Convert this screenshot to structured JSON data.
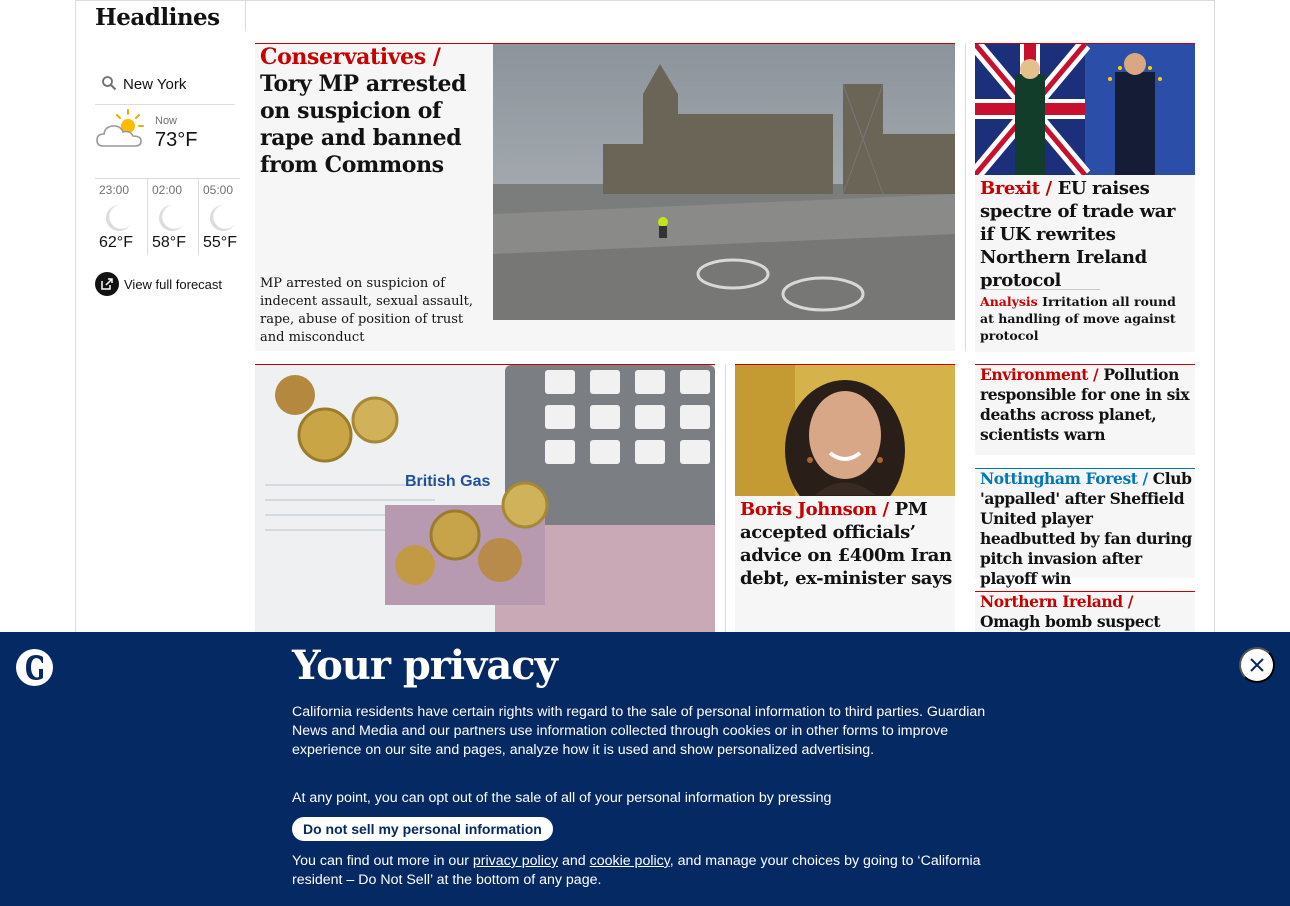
{
  "section": {
    "title": "Headlines"
  },
  "weather": {
    "city": "New York",
    "now_label": "Now",
    "now_temp": "73°F",
    "hours": [
      {
        "time": "23:00",
        "temp": "62°F",
        "icon": "moon-icon"
      },
      {
        "time": "02:00",
        "temp": "58°F",
        "icon": "moon-icon"
      },
      {
        "time": "05:00",
        "temp": "55°F",
        "icon": "moon-icon"
      }
    ],
    "forecast_link": "View full forecast"
  },
  "stories": {
    "main": {
      "kicker": "Conservatives /",
      "headline": "Tory MP arrested on suspicion of rape and banned from Commons",
      "standfirst": "MP arrested on suspicion of indecent assault, sexual assault, rape, abuse of position of trust and misconduct"
    },
    "brexit": {
      "kicker": "Brexit /",
      "headline": "EU raises spectre of trade war if UK rewrites Northern Ireland protocol",
      "analysis_kicker": "Analysis",
      "analysis_text": "Irritation all round at handling of move against protocol"
    },
    "environment": {
      "kicker": "Environment /",
      "headline": "Pollution responsible for one in six deaths across planet, scientists warn"
    },
    "forest": {
      "kicker": "Nottingham Forest /",
      "headline": "Club 'appalled' after Sheffield United player headbutted by fan during pitch invasion after playoff win"
    },
    "ni": {
      "kicker": "Northern Ireland /",
      "headline": "Omagh bomb suspect Liam"
    },
    "boris": {
      "kicker": "Boris Johnson  /",
      "headline": "PM accepted officials’ advice on £400m Iran debt, ex-minister says"
    },
    "money_photo_text": {
      "brand": "British Gas"
    }
  },
  "privacy": {
    "title": "Your privacy",
    "p1": "California residents have certain rights with regard to the sale of personal information to third parties. Guardian News and Media and our partners use information collected through cookies or in other forms to improve experience on our site and pages, analyze how it is used and show personalized advertising.",
    "p2": "At any point, you can opt out of the sale of all of your personal information by pressing",
    "button": "Do not sell my personal information",
    "p3_a": "You can find out more in our ",
    "privacy_link": "privacy policy",
    "p3_b": " and ",
    "cookie_link": "cookie policy",
    "p3_c": ", and manage your choices by going to ‘California resident – Do Not Sell’ at the bottom of any page."
  },
  "colors": {
    "news_red": "#c70000",
    "sport_blue": "#0077b6",
    "banner_navy": "#052962"
  }
}
